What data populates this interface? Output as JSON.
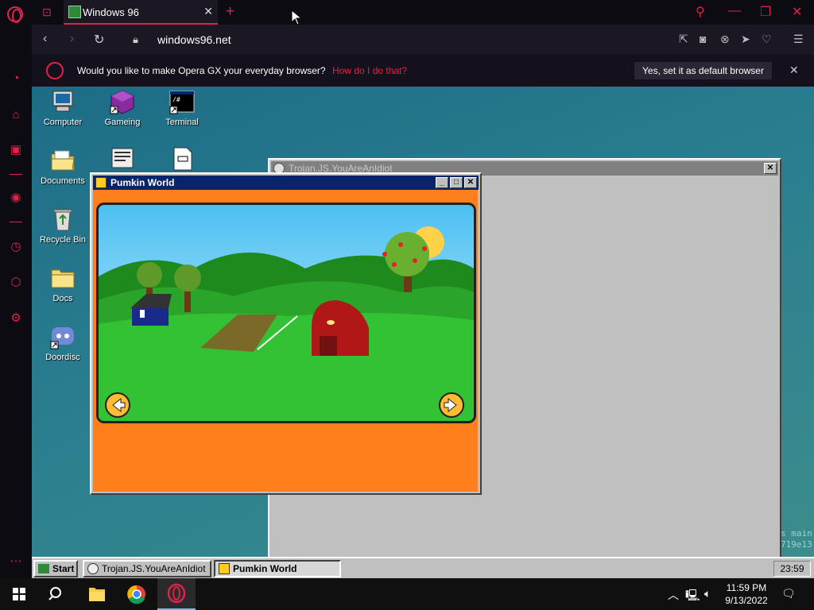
{
  "browser": {
    "tab_title": "Windows 96",
    "tab_close": "✕",
    "new_tab": "+",
    "url": "windows96.net",
    "infobar_text": "Would you like to make Opera GX your everyday browser?",
    "infobar_link": "How do I do that?",
    "infobar_button": "Yes, set it as default browser",
    "infobar_close": "✕"
  },
  "desktop": {
    "icons": [
      {
        "label": "Computer"
      },
      {
        "label": "Gameing"
      },
      {
        "label": "Terminal"
      },
      {
        "label": "Documents"
      },
      {
        "label": "Recycle Bin"
      },
      {
        "label": "Docs"
      },
      {
        "label": "Doordisc"
      }
    ],
    "terminal_glyph": "/#"
  },
  "windows": {
    "trojan": {
      "title": "Trojan.JS.YouAreAnIdiot",
      "close": "✕"
    },
    "pumpkin": {
      "title": "Pumkin World",
      "minimize": "_",
      "maximize": "□",
      "close": "✕"
    }
  },
  "background_text": {
    "line1": "s main",
    "line2": "719e13"
  },
  "w96_taskbar": {
    "start": "Start",
    "tasks": [
      {
        "label": "Trojan.JS.YouAreAnIdiot"
      },
      {
        "label": "Pumkin World"
      }
    ],
    "clock": "23:59"
  },
  "win10_taskbar": {
    "time": "11:59 PM",
    "date": "9/13/2022"
  },
  "colors": {
    "opera_accent": "#e0214b",
    "w96_title_active": "#0a246a",
    "game_orange": "#fe7f1c"
  }
}
